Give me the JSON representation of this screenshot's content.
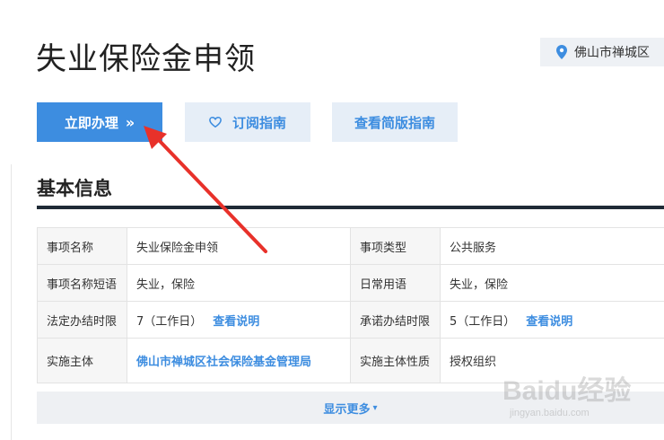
{
  "page": {
    "title": "失业保险金申领",
    "location": "佛山市禅城区"
  },
  "actions": {
    "apply_label": "立即办理",
    "apply_arrows": "»",
    "subscribe_label": "订阅指南",
    "simple_label": "查看简版指南"
  },
  "section": {
    "title": "基本信息"
  },
  "info_table": {
    "rows": [
      {
        "l1": "事项名称",
        "v1": "失业保险金申领",
        "l2": "事项类型",
        "v2": "公共服务"
      },
      {
        "l1": "事项名称短语",
        "v1": "失业，保险",
        "l2": "日常用语",
        "v2": "失业，保险"
      },
      {
        "l1": "法定办结时限",
        "v1": "7（工作日）",
        "v1_link": "查看说明",
        "l2": "承诺办结时限",
        "v2": "5（工作日）",
        "v2_link": "查看说明"
      },
      {
        "l1": "实施主体",
        "v1": "佛山市禅城区社会保险基金管理局",
        "l2": "实施主体性质",
        "v2": "授权组织"
      }
    ]
  },
  "show_more": {
    "label": "显示更多"
  },
  "watermark": {
    "brand": "Baidu经验",
    "url": "jingyan.baidu.com"
  },
  "colors": {
    "accent": "#3d8de0",
    "annotation_arrow": "#e8312a"
  },
  "icons": {
    "location": "map-pin-icon",
    "subscribe": "heart-icon",
    "apply": "double-chevron-right-icon",
    "more": "chevron-down-icon"
  }
}
